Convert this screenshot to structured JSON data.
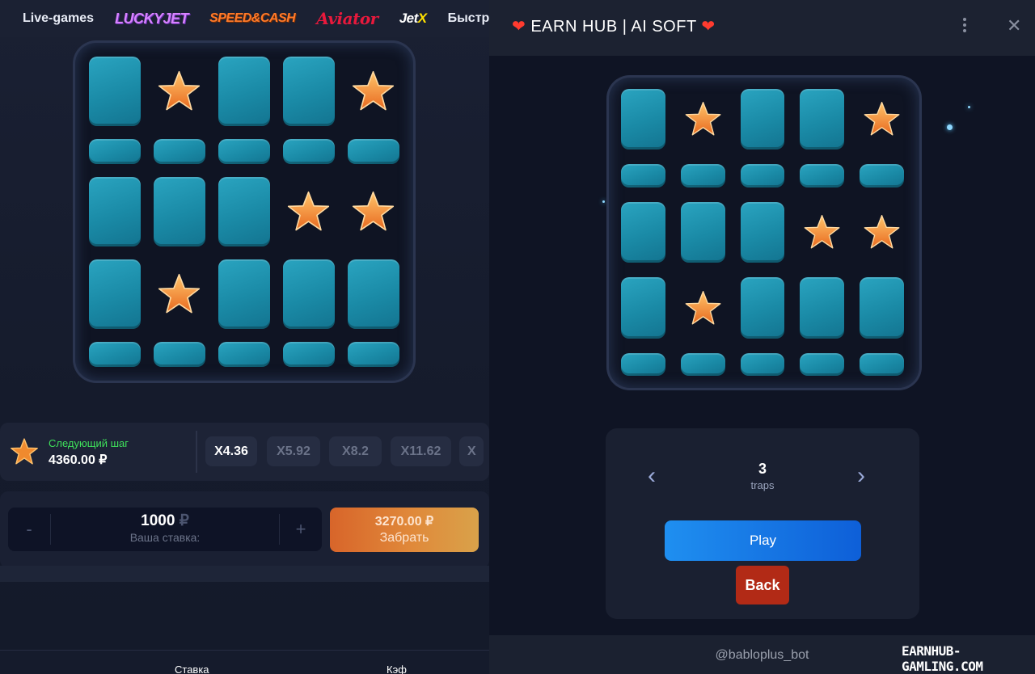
{
  "left": {
    "nav": {
      "live_games": "Live-games",
      "logos": [
        "LUCKYJET",
        "SPEED&CASH",
        "Aviator",
        "JetX"
      ],
      "fast_games": "Быстрые игры"
    },
    "grid": [
      [
        "tile",
        "star",
        "tile",
        "tile",
        "star"
      ],
      [
        "tile",
        "tile",
        "tile",
        "tile",
        "tile"
      ],
      [
        "tile",
        "tile",
        "tile",
        "star",
        "star"
      ],
      [
        "tile",
        "star",
        "tile",
        "tile",
        "tile"
      ],
      [
        "tile",
        "tile",
        "tile",
        "tile",
        "tile"
      ]
    ],
    "next_step": {
      "label": "Следующий шаг",
      "amount": "4360.00 ₽"
    },
    "multipliers": [
      "X4.36",
      "X5.92",
      "X8.2",
      "X11.62",
      "X"
    ],
    "bet": {
      "minus": "-",
      "plus": "+",
      "value": "1000",
      "currency": "₽",
      "label": "Ваша ставка:"
    },
    "cashout": {
      "amount": "3270.00 ₽",
      "label": "Забрать"
    },
    "tabs": {
      "bet": "Ставка",
      "coef": "Кэф"
    }
  },
  "right": {
    "header": {
      "heart": "❤",
      "title": "EARN HUB | AI SOFT"
    },
    "grid": [
      [
        "tile",
        "star",
        "tile",
        "tile",
        "star"
      ],
      [
        "tile",
        "tile",
        "tile",
        "tile",
        "tile"
      ],
      [
        "tile",
        "tile",
        "tile",
        "star",
        "star"
      ],
      [
        "tile",
        "star",
        "tile",
        "tile",
        "tile"
      ],
      [
        "tile",
        "tile",
        "tile",
        "tile",
        "tile"
      ]
    ],
    "traps": {
      "value": "3",
      "label": "traps",
      "prev": "‹",
      "next": "›"
    },
    "play_label": "Play",
    "back_label": "Back",
    "footer": {
      "bot": "@bablopluѕ_bot",
      "watermark": "EARNHUB-GAMLING.COM"
    }
  }
}
